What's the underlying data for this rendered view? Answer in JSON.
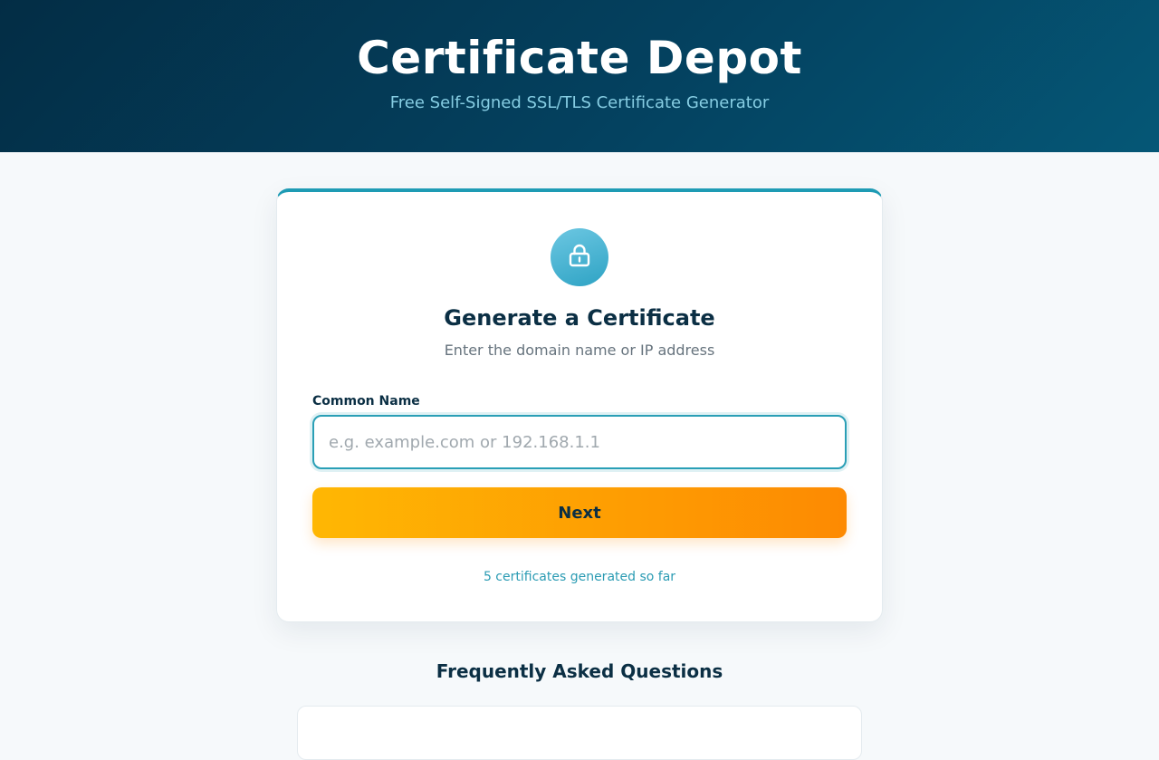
{
  "header": {
    "title": "Certificate Depot",
    "subtitle": "Free Self-Signed SSL/TLS Certificate Generator"
  },
  "card": {
    "icon": "lock-icon",
    "title": "Generate a Certificate",
    "subtitle": "Enter the domain name or IP address",
    "field_label": "Common Name",
    "input_value": "",
    "input_placeholder": "e.g. example.com or 192.168.1.1",
    "next_label": "Next",
    "counter_text": "5 certificates generated so far"
  },
  "faq": {
    "title": "Frequently Asked Questions"
  },
  "colors": {
    "header_bg": "#04415f",
    "accent": "#2a9fb6",
    "button_start": "#ffb703",
    "button_end": "#fd8a02",
    "text_dark": "#0b2f44"
  }
}
